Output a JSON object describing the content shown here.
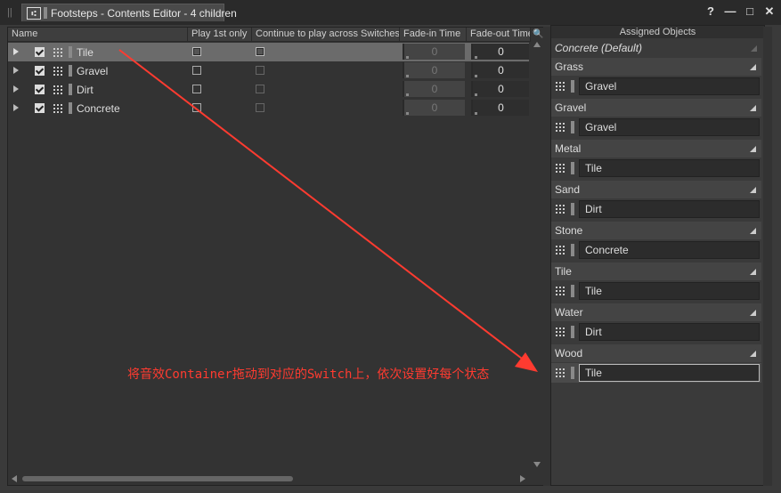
{
  "window": {
    "tab_title": "Footsteps - Contents Editor - 4 children",
    "help_label": "?",
    "minimize_label": "—",
    "maximize_label": "□",
    "close_label": "✕"
  },
  "table": {
    "columns": [
      "Name",
      "Play 1st only",
      "Continue to play across Switches",
      "Fade-in Time",
      "Fade-out Time"
    ],
    "rows": [
      {
        "name": "Tile",
        "fade_in": "0",
        "fade_out": "0"
      },
      {
        "name": "Gravel",
        "fade_in": "0",
        "fade_out": "0"
      },
      {
        "name": "Dirt",
        "fade_in": "0",
        "fade_out": "0"
      },
      {
        "name": "Concrete",
        "fade_in": "0",
        "fade_out": "0"
      }
    ]
  },
  "assigned": {
    "title": "Assigned Objects",
    "default_label": "Concrete (Default)",
    "switches": [
      {
        "label": "Grass",
        "object": "Gravel"
      },
      {
        "label": "Gravel",
        "object": "Gravel"
      },
      {
        "label": "Metal",
        "object": "Tile"
      },
      {
        "label": "Sand",
        "object": "Dirt"
      },
      {
        "label": "Stone",
        "object": "Concrete"
      },
      {
        "label": "Tile",
        "object": "Tile"
      },
      {
        "label": "Water",
        "object": "Dirt"
      },
      {
        "label": "Wood",
        "object": "Tile"
      }
    ]
  },
  "annotation": {
    "text": "将音效Container拖动到对应的Switch上，依次设置好每个状态",
    "color": "#ff3b30"
  }
}
